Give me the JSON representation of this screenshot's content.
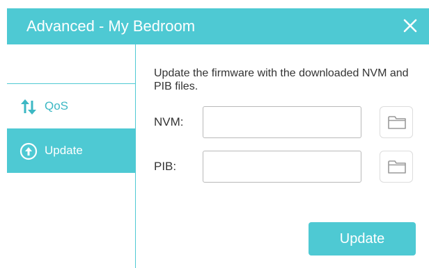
{
  "window": {
    "title": "Advanced - My Bedroom",
    "close_icon": "close-icon"
  },
  "colors": {
    "accent": "#4ec9d3",
    "accent_text": "#3cb8c4",
    "body_text": "#333333"
  },
  "sidebar": {
    "items": [
      {
        "label": "QoS",
        "icon": "qos-arrows-icon",
        "active": false
      },
      {
        "label": "Update",
        "icon": "upload-circle-icon",
        "active": true
      }
    ]
  },
  "update": {
    "description": "Update the firmware with the downloaded NVM and PIB files.",
    "nvm_label": "NVM:",
    "nvm_value": "",
    "pib_label": "PIB:",
    "pib_value": "",
    "browse_icon": "folder-icon",
    "button_label": "Update"
  }
}
